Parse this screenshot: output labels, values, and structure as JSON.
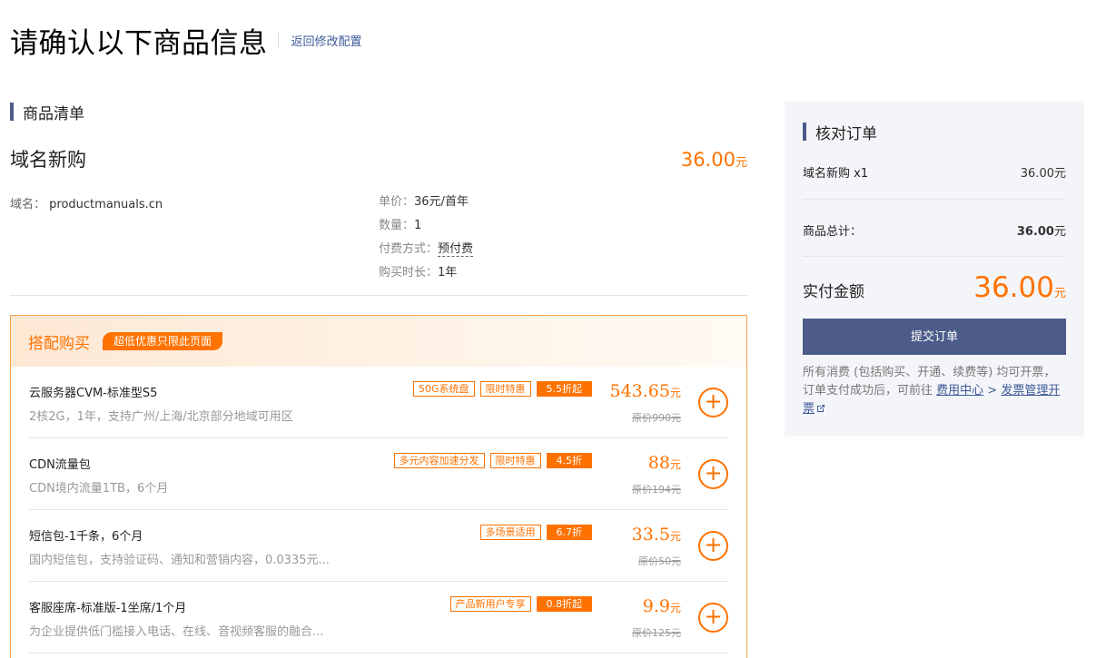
{
  "header": {
    "title": "请确认以下商品信息",
    "back_link": "返回修改配置"
  },
  "goods": {
    "section_title": "商品清单",
    "product_name": "域名新购",
    "price": "36.00",
    "price_unit": "元",
    "domain_label": "域名：",
    "domain_value": "productmanuals.cn",
    "specs": [
      {
        "label": "单价：",
        "value": "36元/首年"
      },
      {
        "label": "数量：",
        "value": "1"
      },
      {
        "label": "付费方式：",
        "value": "预付费"
      },
      {
        "label": "购买时长：",
        "value": "1年"
      }
    ]
  },
  "bundle": {
    "title": "搭配购买",
    "badge": "超低优惠只限此页面",
    "price_unit": "元",
    "add_symbol": "+",
    "items": [
      {
        "name": "云服务器CVM-标准型S5",
        "desc": "2核2G，1年，支持广州/上海/北京部分地域可用区",
        "tags": [
          "50G系统盘",
          "限时特惠"
        ],
        "discount": "5.5折起",
        "price": "543.65",
        "original": "原价990元"
      },
      {
        "name": "CDN流量包",
        "desc": "CDN境内流量1TB，6个月",
        "tags": [
          "多元内容加速分发",
          "限时特惠"
        ],
        "discount": "4.5折",
        "price": "88",
        "original": "原价194元"
      },
      {
        "name": "短信包-1千条，6个月",
        "desc": "国内短信包，支持验证码、通知和营销内容，0.0335元...",
        "tags": [
          "多场景适用"
        ],
        "discount": "6.7折",
        "price": "33.5",
        "original": "原价50元"
      },
      {
        "name": "客服座席-标准版-1坐席/1个月",
        "desc": "为企业提供低门槛接入电话、在线、音视频客服的融合...",
        "tags": [
          "产品新用户专享"
        ],
        "discount": "0.8折起",
        "price": "9.9",
        "original": "原价125元"
      }
    ]
  },
  "order": {
    "section_title": "核对订单",
    "line_item_label": "域名新购 x1",
    "line_item_value": "36.00",
    "total_label": "商品总计：",
    "total_value": "36.00",
    "unit": "元",
    "pay_label": "实付金额",
    "pay_value": "36.00",
    "submit_label": "提交订单",
    "notice_text": "所有消费 (包括购买、开通、续费等) 均可开票，订单支付成功后，可前往",
    "notice_link1": "费用中心",
    "notice_sep": " > ",
    "notice_link2": "发票管理开票"
  },
  "colors": {
    "accent": "#ff7200",
    "primary": "#4c5b8a",
    "link": "#3e5b99"
  }
}
